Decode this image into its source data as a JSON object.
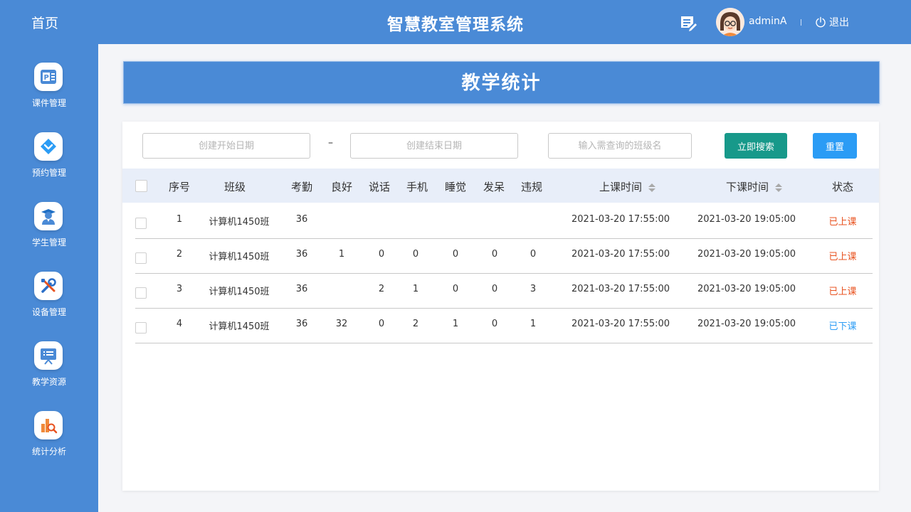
{
  "header": {
    "home": "首页",
    "title": "智慧教室管理系统",
    "username": "adminA",
    "logout": "退出"
  },
  "sidebar": {
    "items": [
      {
        "label": "课件管理",
        "icon": "courseware-icon"
      },
      {
        "label": "预约管理",
        "icon": "reservation-icon"
      },
      {
        "label": "学生管理",
        "icon": "student-icon"
      },
      {
        "label": "设备管理",
        "icon": "device-tools-icon"
      },
      {
        "label": "教学资源",
        "icon": "teaching-resource-icon"
      },
      {
        "label": "统计分析",
        "icon": "statistics-icon"
      }
    ]
  },
  "page": {
    "title": "教学统计"
  },
  "filters": {
    "start_placeholder": "创建开始日期",
    "separator": "–",
    "end_placeholder": "创建结束日期",
    "class_placeholder": "输入需查询的班级名",
    "search_label": "立即搜索",
    "reset_label": "重置"
  },
  "table": {
    "headers": {
      "index": "序号",
      "class": "班级",
      "attendance": "考勤",
      "good": "良好",
      "talking": "说话",
      "phone": "手机",
      "sleeping": "睡觉",
      "daze": "发呆",
      "violation": "违规",
      "start_time": "上课时间",
      "end_time": "下课时间",
      "status": "状态"
    },
    "rows": [
      {
        "index": "1",
        "class": "计算机1450班",
        "attendance": "36",
        "good": "",
        "talking": "",
        "phone": "",
        "sleeping": "",
        "daze": "",
        "violation": "",
        "start_time": "2021-03-20 17:55:00",
        "end_time": "2021-03-20 19:05:00",
        "status": "已上课"
      },
      {
        "index": "2",
        "class": "计算机1450班",
        "attendance": "36",
        "good": "1",
        "talking": "0",
        "phone": "0",
        "sleeping": "0",
        "daze": "0",
        "violation": "0",
        "start_time": "2021-03-20 17:55:00",
        "end_time": "2021-03-20 19:05:00",
        "status": "已上课"
      },
      {
        "index": "3",
        "class": "计算机1450班",
        "attendance": "36",
        "good": "",
        "talking": "2",
        "phone": "1",
        "sleeping": "0",
        "daze": "0",
        "violation": "3",
        "start_time": "2021-03-20 17:55:00",
        "end_time": "2021-03-20 19:05:00",
        "status": "已上课"
      },
      {
        "index": "4",
        "class": "计算机1450班",
        "attendance": "36",
        "good": "32",
        "talking": "0",
        "phone": "2",
        "sleeping": "1",
        "daze": "0",
        "violation": "1",
        "start_time": "2021-03-20 17:55:00",
        "end_time": "2021-03-20 19:05:00",
        "status": "已下课"
      }
    ]
  },
  "colors": {
    "primary": "#4a8ad6",
    "search_button": "#17998a",
    "reset_button": "#2b9cf5",
    "status_in_class": "#e8521f",
    "status_finished": "#2b9cf5"
  }
}
